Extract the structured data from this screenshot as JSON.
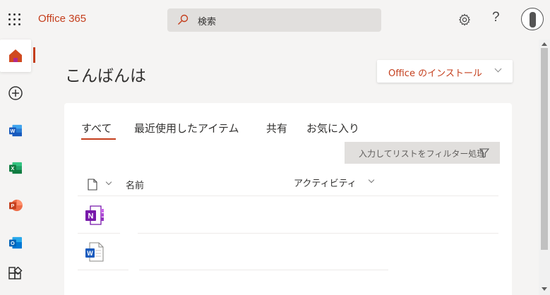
{
  "header": {
    "brand": "Office 365",
    "search_placeholder": "検索"
  },
  "rail": {
    "items": [
      {
        "name": "home",
        "active": true
      },
      {
        "name": "create"
      },
      {
        "name": "word"
      },
      {
        "name": "excel"
      },
      {
        "name": "powerpoint"
      },
      {
        "name": "outlook"
      },
      {
        "name": "all-apps"
      }
    ]
  },
  "main": {
    "greeting": "こんばんは",
    "install_label": "Office のインストール"
  },
  "tabs": [
    "すべて",
    "最近使用したアイテム",
    "共有",
    "お気に入り"
  ],
  "filter": {
    "placeholder": "入力してリストをフィルター処理"
  },
  "table": {
    "columns": {
      "name": "名前",
      "activity": "アクティビティ"
    },
    "rows": [
      {
        "app": "onenote"
      },
      {
        "app": "word"
      }
    ]
  },
  "colors": {
    "accent": "#c43e1c",
    "word": "#2b579a",
    "excel": "#217346",
    "powerpoint": "#d24726",
    "outlook": "#0078d4",
    "onenote": "#7719aa"
  }
}
